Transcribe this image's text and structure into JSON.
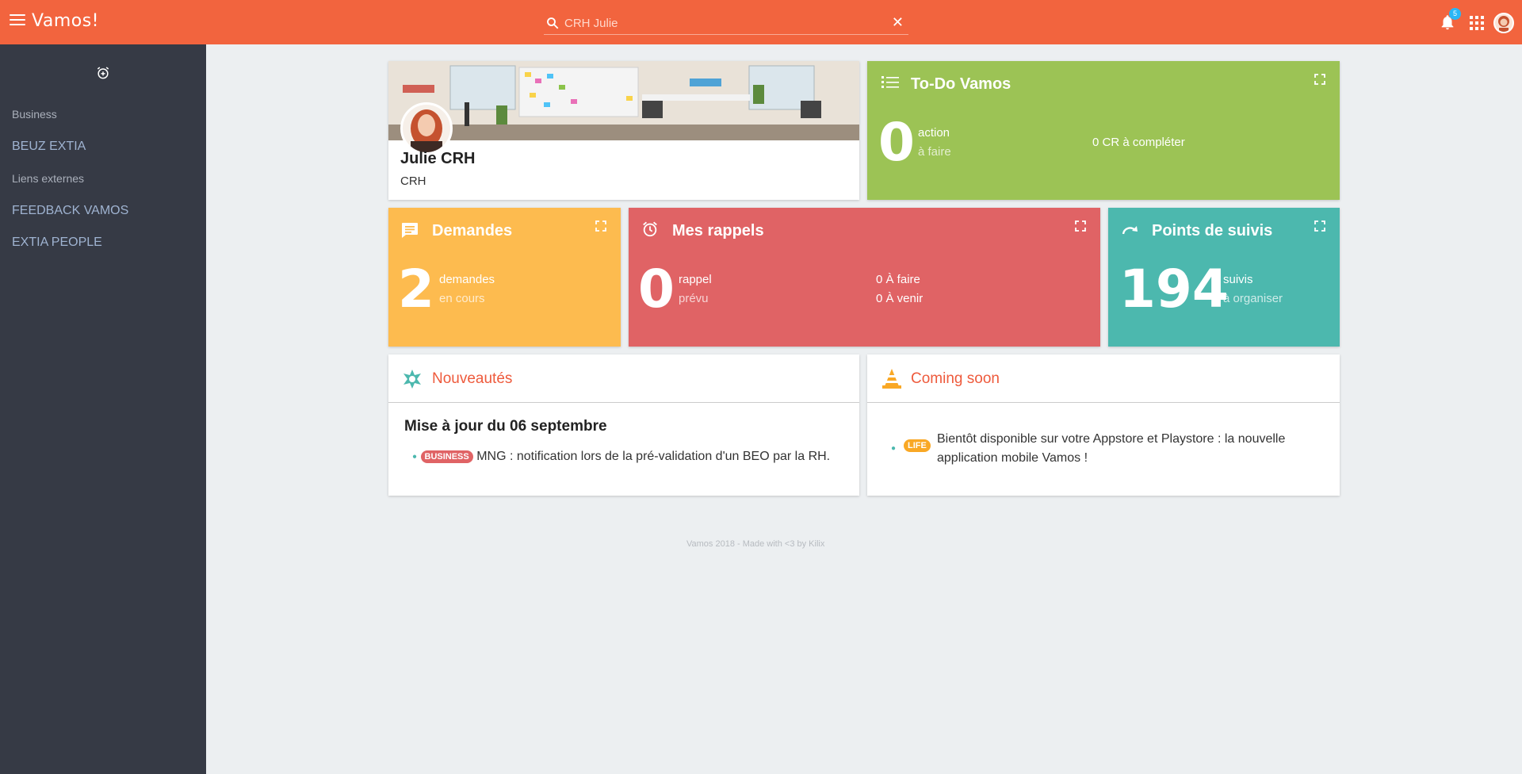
{
  "app": {
    "brand": "Vamos!",
    "search_value": "CRH Julie",
    "notifications_count": "5"
  },
  "sidebar": {
    "sections": [
      {
        "heading": "Business",
        "links": [
          "BEUZ EXTIA"
        ]
      },
      {
        "heading": "Liens externes",
        "links": [
          "FEEDBACK VAMOS",
          "EXTIA PEOPLE"
        ]
      }
    ]
  },
  "profile": {
    "name": "Julie CRH",
    "role": "CRH"
  },
  "todo": {
    "title": "To-Do Vamos",
    "count": "0",
    "label": "action",
    "sub": "à faire",
    "right": "0 CR à compléter"
  },
  "demandes": {
    "title": "Demandes",
    "count": "2",
    "label": "demandes",
    "sub": "en cours"
  },
  "rappels": {
    "title": "Mes rappels",
    "count": "0",
    "label": "rappel",
    "sub": "prévu",
    "right1": "0 À faire",
    "right2": "0 À venir"
  },
  "suivis": {
    "title": "Points de suivis",
    "count": "194",
    "label": "suivis",
    "sub": "à organiser"
  },
  "news": {
    "title": "Nouveautés",
    "heading": "Mise à jour du 06 septembre",
    "items": [
      {
        "badge": "BUSINESS",
        "text": "MNG : notification lors de la pré-validation d'un BEO par la RH."
      }
    ]
  },
  "coming": {
    "title": "Coming soon",
    "items": [
      {
        "badge": "LIFE",
        "line1": "Bientôt disponible sur votre Appstore et Playstore : la nouvelle",
        "line2": "application mobile Vamos !"
      }
    ]
  },
  "footer": "Vamos 2018 - Made with <3 by Kilix",
  "colors": {
    "topbar": "#f2643e",
    "sidebar": "#363a45",
    "todo": "#9cc355",
    "demandes": "#fdbb4f",
    "rappels": "#e06365",
    "suivis": "#4cb8ae",
    "accent_text": "#ee5a3c",
    "badge_business": "#e06365",
    "badge_life": "#f9a825"
  }
}
